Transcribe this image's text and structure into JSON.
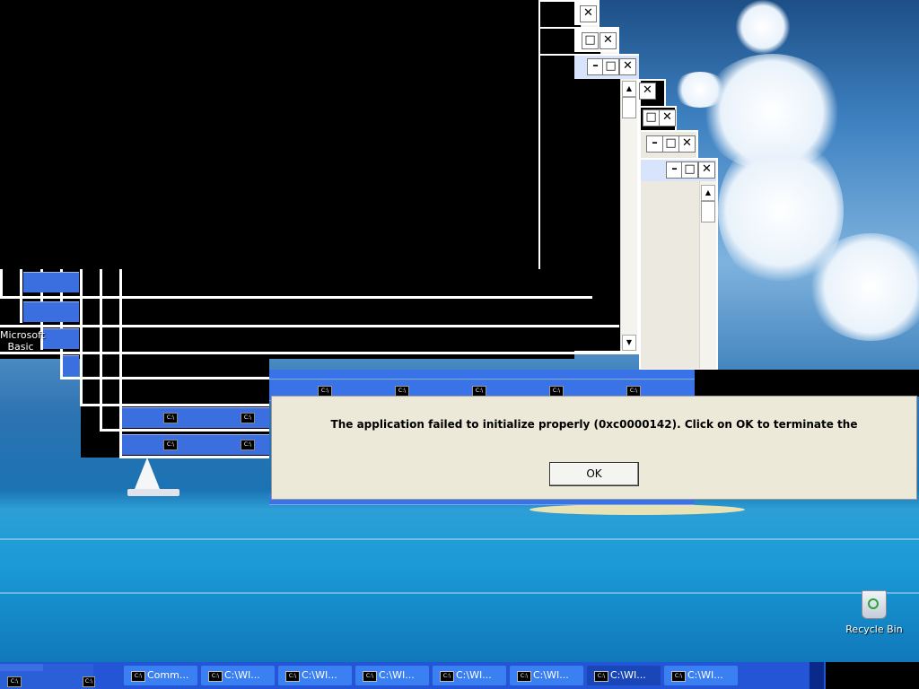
{
  "desktop": {
    "icons": [
      {
        "label_line1": "Microsoft",
        "label_line2": "Basic"
      },
      {
        "label": "Recycle Bin"
      }
    ]
  },
  "cmd_icon_text": "C:\\",
  "error_dialog": {
    "message": "The application failed to initialize properly (0xc0000142). Click on OK to terminate the",
    "ok_label": "OK"
  },
  "window_controls": {
    "minimize": "–",
    "maximize": "□",
    "close": "✕"
  },
  "taskbar": {
    "buttons": [
      {
        "label": "Comm...",
        "active": false
      },
      {
        "label": "C:\\WI...",
        "active": false
      },
      {
        "label": "C:\\WI...",
        "active": false
      },
      {
        "label": "C:\\WI...",
        "active": false
      },
      {
        "label": "C:\\WI...",
        "active": false
      },
      {
        "label": "C:\\WI...",
        "active": false
      },
      {
        "label": "C:\\WI...",
        "active": true
      },
      {
        "label": "C:\\WI...",
        "active": false
      }
    ]
  }
}
